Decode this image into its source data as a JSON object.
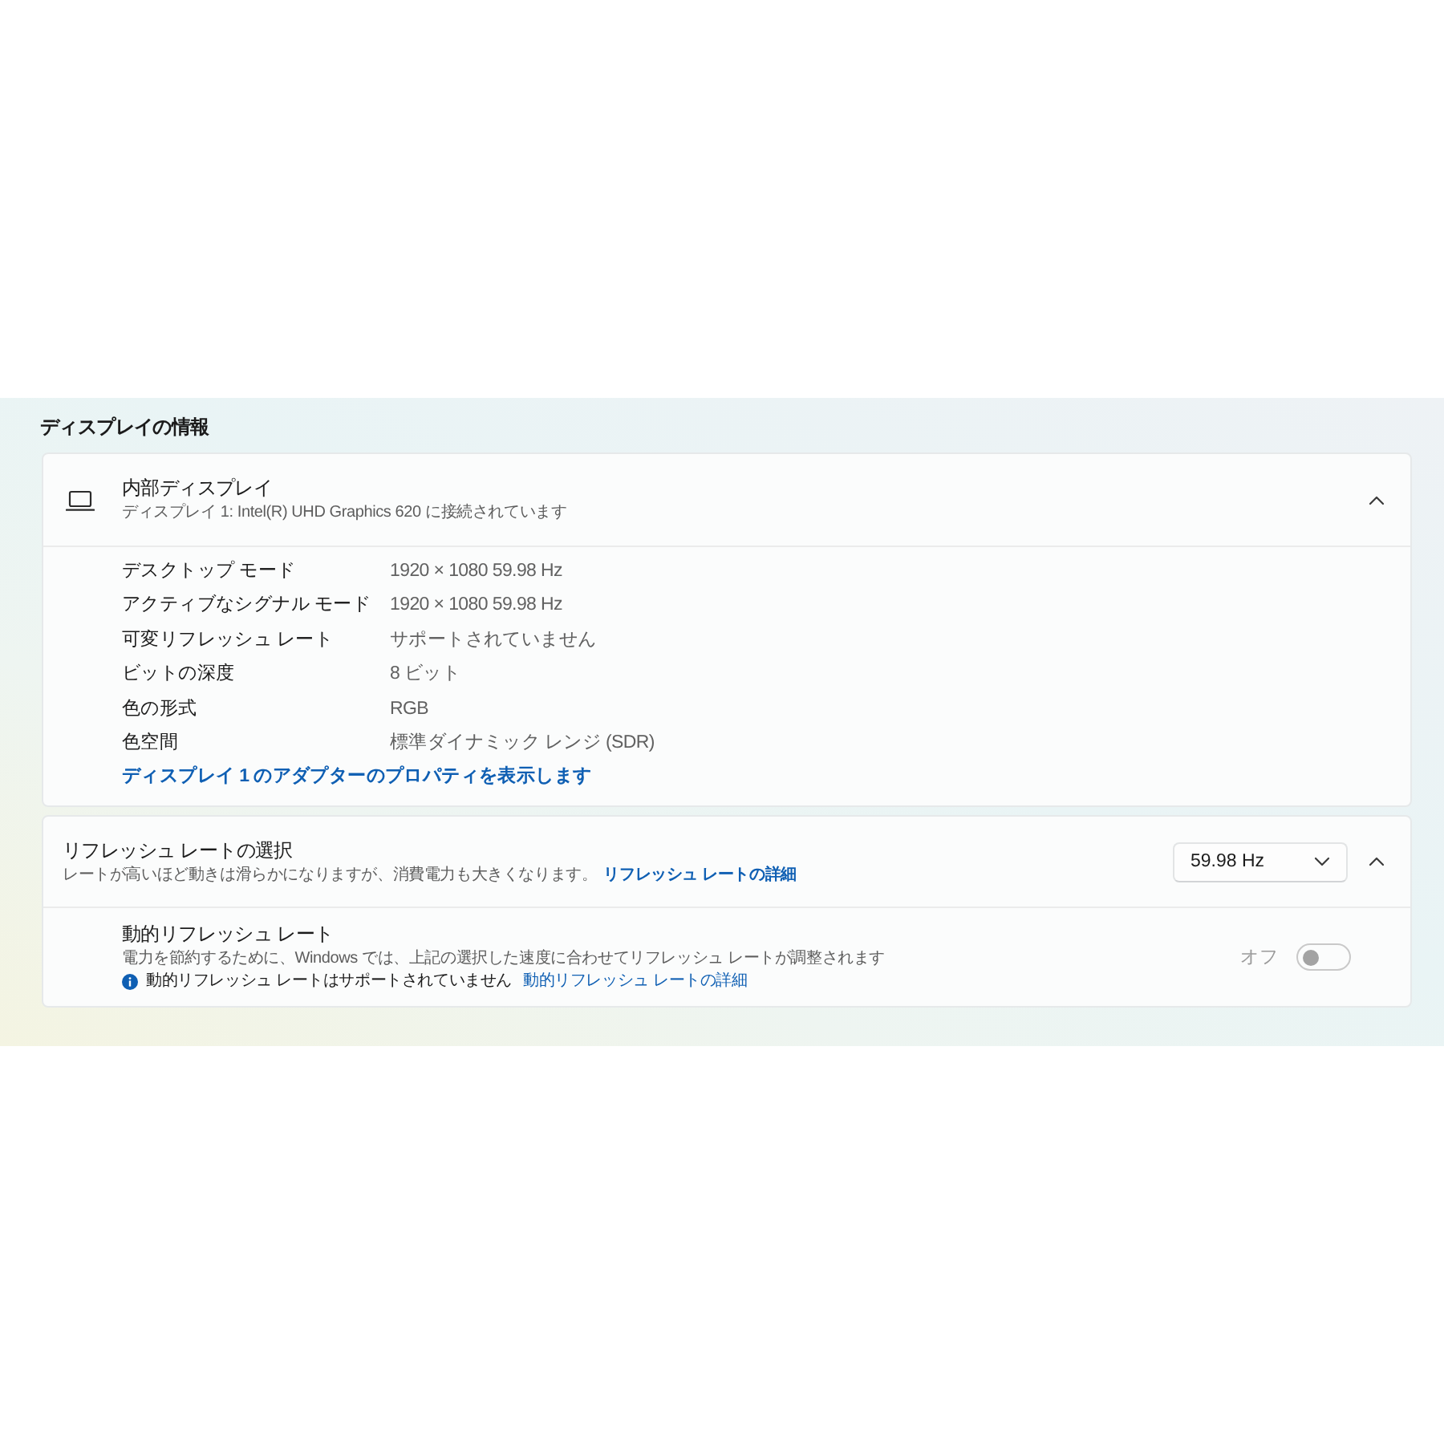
{
  "section_title": "ディスプレイの情報",
  "display_card": {
    "title": "内部ディスプレイ",
    "subtitle": "ディスプレイ 1: Intel(R) UHD Graphics 620 に接続されています",
    "expanded": true,
    "properties": [
      {
        "label": "デスクトップ モード",
        "value": "1920 × 1080 59.98 Hz"
      },
      {
        "label": "アクティブなシグナル モード",
        "value": "1920 × 1080 59.98 Hz"
      },
      {
        "label": "可変リフレッシュ レート",
        "value": "サポートされていません"
      },
      {
        "label": "ビットの深度",
        "value": "8 ビット"
      },
      {
        "label": "色の形式",
        "value": "RGB"
      },
      {
        "label": "色空間",
        "value": "標準ダイナミック レンジ (SDR)"
      }
    ],
    "link": "ディスプレイ 1 のアダプターのプロパティを表示します"
  },
  "refresh_card": {
    "title": "リフレッシュ レートの選択",
    "description": "レートが高いほど動きは滑らかになりますが、消費電力も大きくなります。",
    "link": "リフレッシュ レートの詳細",
    "dropdown": {
      "value": "59.98 Hz"
    },
    "expanded": true,
    "dynamic": {
      "title": "動的リフレッシュ レート",
      "description": "電力を節約するために、Windows では、上記の選択した速度に合わせてリフレッシュ レートが調整されます",
      "notice": "動的リフレッシュ レートはサポートされていません",
      "link": "動的リフレッシュ レートの詳細",
      "toggle": {
        "label": "オフ",
        "on": false,
        "disabled": true
      }
    }
  }
}
